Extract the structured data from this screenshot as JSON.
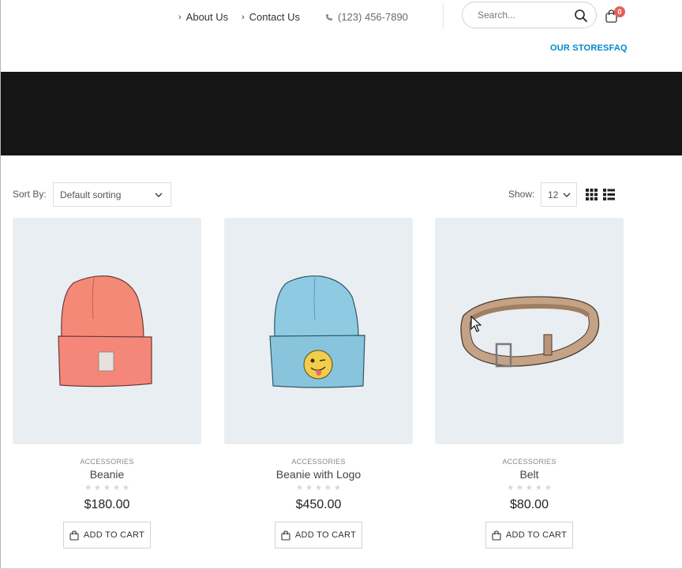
{
  "header": {
    "links": [
      {
        "label": "About Us"
      },
      {
        "label": "Contact Us"
      }
    ],
    "phone": "(123) 456-7890",
    "search": {
      "placeholder": "Search..."
    },
    "cart_count": "0",
    "nav": [
      "OUR STORES",
      "FAQ"
    ]
  },
  "toolbar": {
    "sort_label": "Sort By:",
    "sort_value": "Default sorting",
    "show_label": "Show:",
    "show_value": "12"
  },
  "products": [
    {
      "category": "ACCESSORIES",
      "name": "Beanie",
      "price": "$180.00",
      "rating": 0,
      "button": "ADD TO CART",
      "color": "#f4897a"
    },
    {
      "category": "ACCESSORIES",
      "name": "Beanie with Logo",
      "price": "$450.00",
      "rating": 0,
      "button": "ADD TO CART",
      "color": "#8ec9e0"
    },
    {
      "category": "ACCESSORIES",
      "name": "Belt",
      "price": "$80.00",
      "rating": 0,
      "button": "ADD TO CART",
      "color": "#c9a98e"
    }
  ],
  "colors": {
    "accent": "#0188cc",
    "badge": "#e36159",
    "banner": "#151515",
    "product_bg": "#e9eef3"
  }
}
